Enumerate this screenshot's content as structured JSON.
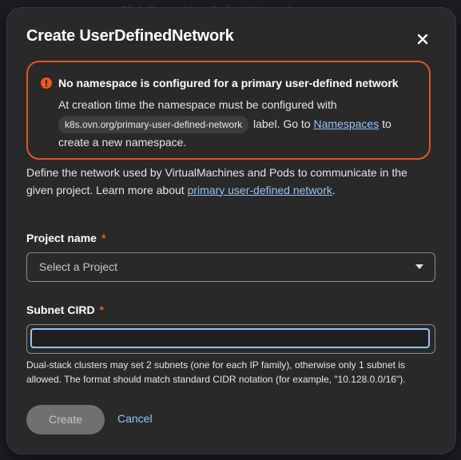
{
  "background": {
    "text": "Click Create User Defined Network ... "
  },
  "modal": {
    "title": "Create UserDefinedNetwork",
    "close_icon": "close-icon"
  },
  "alert": {
    "icon": "exclamation-circle-icon",
    "title": "No namespace is configured for a primary user-defined network",
    "body_prefix": "At creation time the namespace must be configured with",
    "code_label": "k8s.ovn.org/primary-user-defined-network",
    "body_mid": " label. Go to ",
    "link_namespaces": "Namespaces",
    "body_suffix": " to create a new namespace.",
    "border_color": "#e0562b"
  },
  "description": {
    "text": "Define the network used by VirtualMachines and Pods to communicate in the given project. Learn more about ",
    "link": "primary user-defined network",
    "suffix": "."
  },
  "project": {
    "label": "Project name",
    "required_mark": "*",
    "placeholder": "Select a Project"
  },
  "subnet": {
    "label": "Subnet CIRD",
    "required_mark": "*",
    "value": "",
    "helper": "Dual-stack clusters may set 2 subnets (one for each IP family), otherwise only 1 subnet is allowed. The format should match standard CIDR notation (for example, \"10.128.0.0/16\")."
  },
  "actions": {
    "create_label": "Create",
    "cancel_label": "Cancel"
  },
  "colors": {
    "link": "#92c5f9",
    "required": "#f0561d",
    "modal_bg": "#292929"
  }
}
